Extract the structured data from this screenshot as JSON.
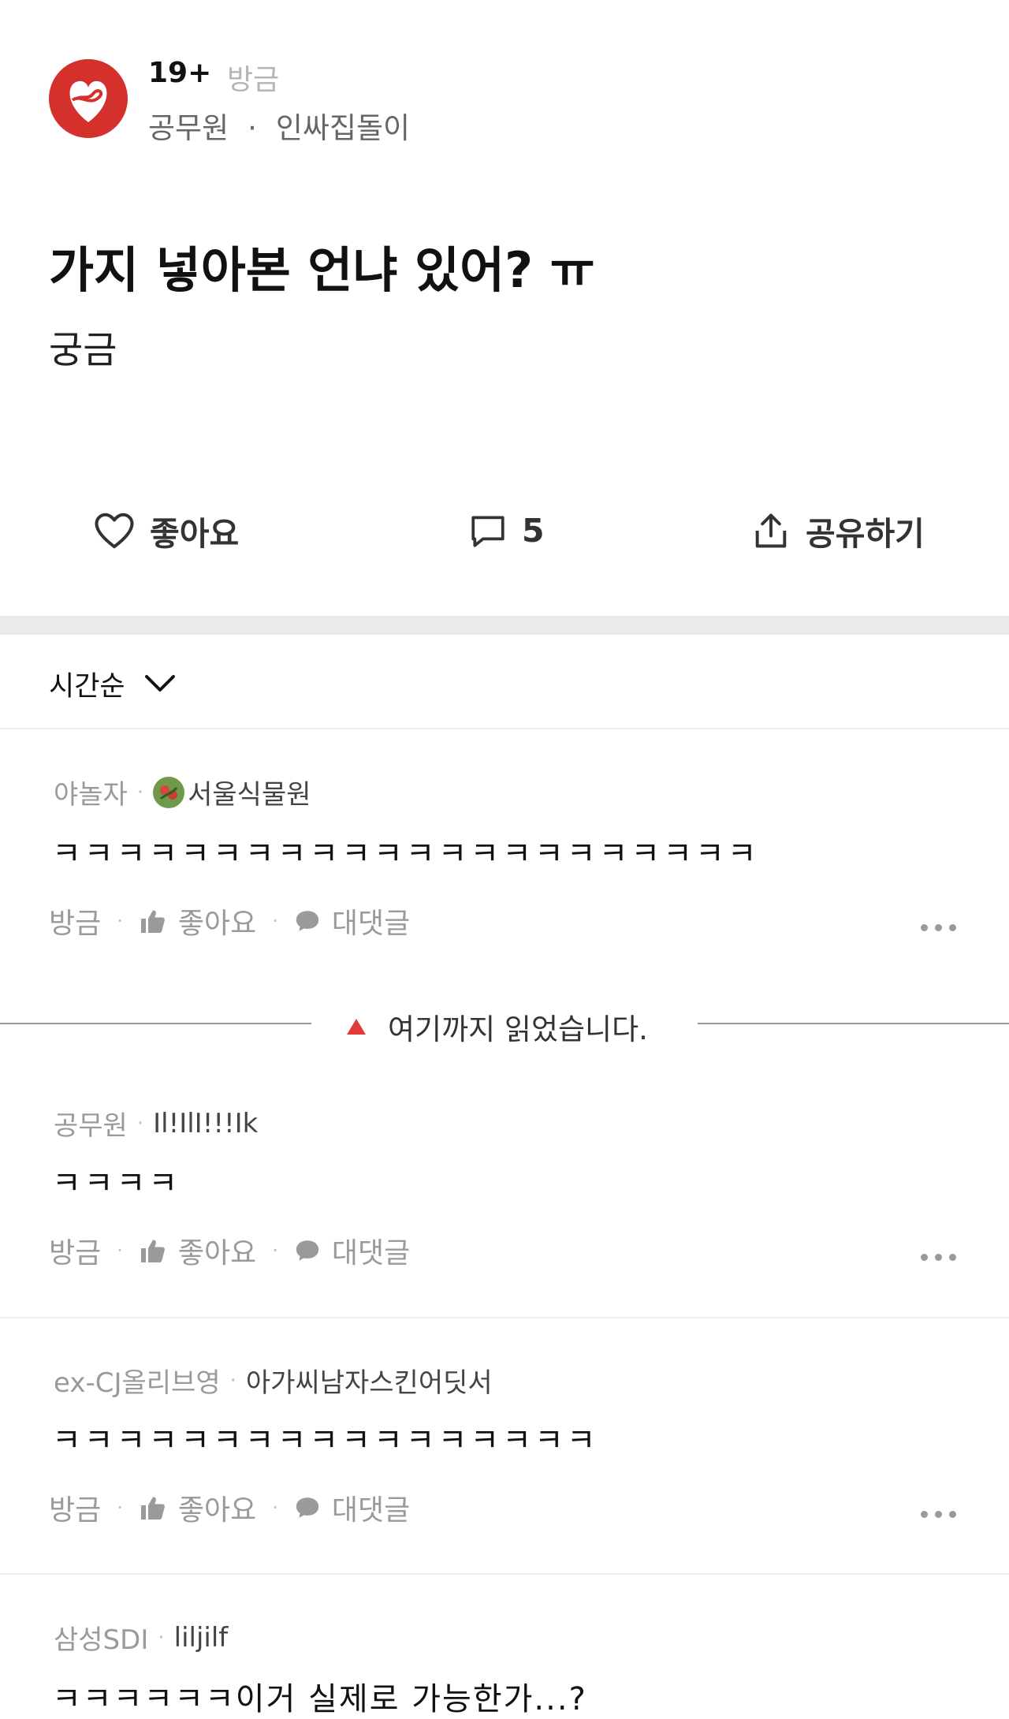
{
  "post": {
    "board": "19+",
    "time": "방금",
    "company": "공무원",
    "author": "인싸집돌이",
    "title": "가지 넣아본 언냐 있어? ㅠ",
    "body": "궁금"
  },
  "actions": {
    "like_label": "좋아요",
    "comment_count": "5",
    "share_label": "공유하기"
  },
  "sort": {
    "label": "시간순"
  },
  "read_marker": {
    "label": "여기까지 읽었습니다."
  },
  "comments": [
    {
      "company": "야놀자",
      "nickname": "서울식물원",
      "text": "ㅋㅋㅋㅋㅋㅋㅋㅋㅋㅋㅋㅋㅋㅋㅋㅋㅋㅋㅋㅋㅋㅋ",
      "time": "방금",
      "like_label": "좋아요",
      "reply_label": "대댓글"
    },
    {
      "company": "공무원",
      "nickname": "Il!IlI!!!Ik",
      "text": "ㅋㅋㅋㅋ",
      "time": "방금",
      "like_label": "좋아요",
      "reply_label": "대댓글"
    },
    {
      "company": "ex-CJ올리브영",
      "nickname": "아가씨남자스킨어딧서",
      "text": "ㅋㅋㅋㅋㅋㅋㅋㅋㅋㅋㅋㅋㅋㅋㅋㅋㅋ",
      "time": "방금",
      "like_label": "좋아요",
      "reply_label": "대댓글"
    },
    {
      "company": "삼성SDI",
      "nickname": "liljilf",
      "text": "ㅋㅋㅋㅋㅋㅋ이거 실제로 가능한가...?"
    }
  ],
  "colors": {
    "avatar": "#d4312c",
    "read_marker": "#e03a3a"
  }
}
